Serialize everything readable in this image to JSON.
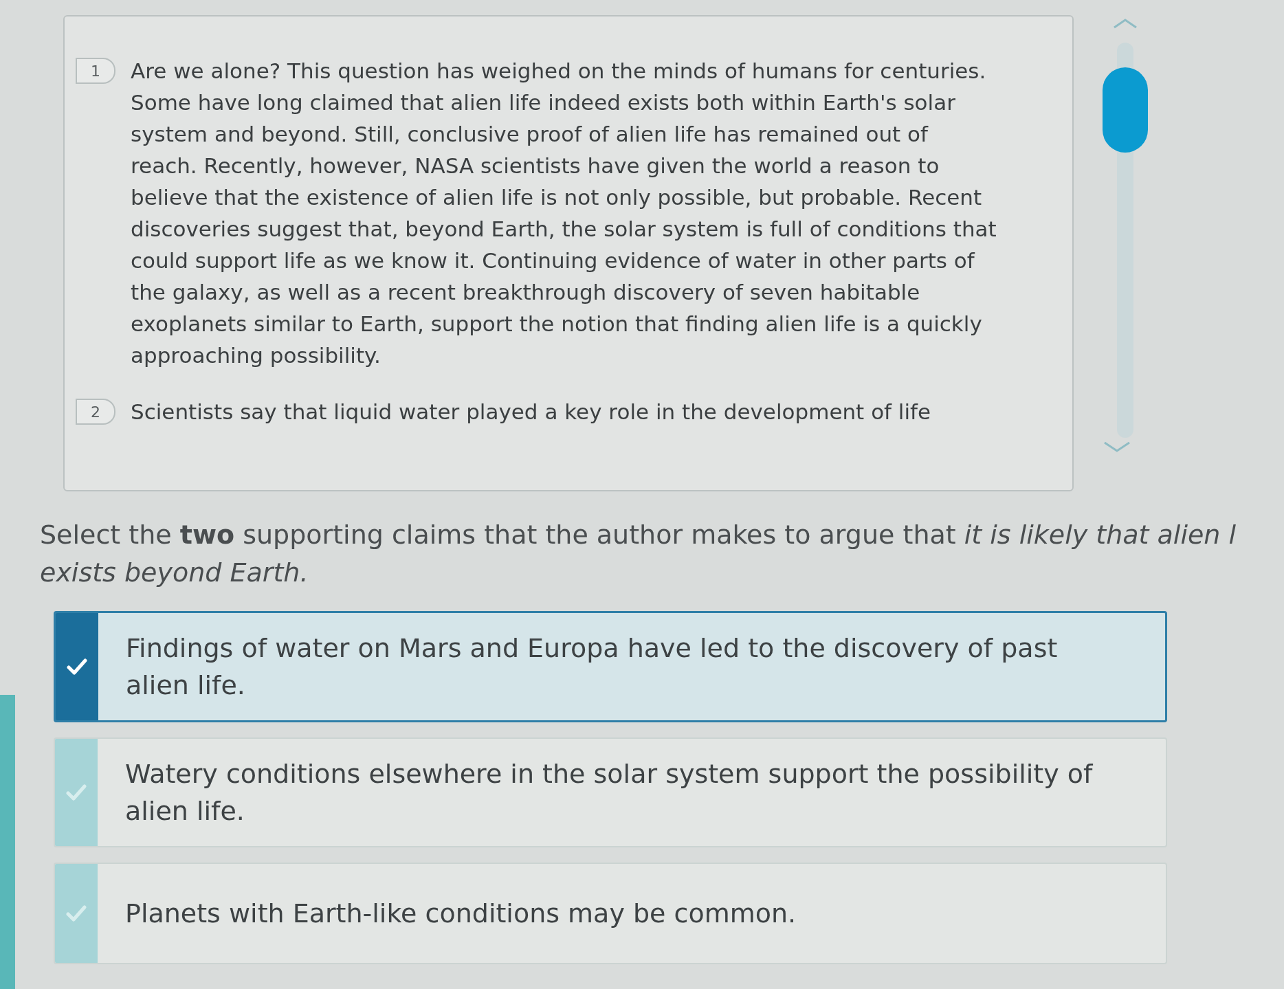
{
  "passage": {
    "paragraphs": [
      {
        "number": "1",
        "text": "Are we alone? This question has weighed on the minds of humans for centuries. Some have long claimed that alien life indeed exists both within Earth's solar system and beyond. Still, conclusive proof of alien life has remained out of reach. Recently, however, NASA scientists have given the world a reason to believe that the existence of alien life is not only possible, but probable. Recent discoveries suggest that, beyond Earth, the solar system is full of conditions that could support life as we know it. Continuing evidence of water in other parts of the galaxy, as well as a recent breakthrough discovery of seven habitable exoplanets similar to Earth, support the notion that finding alien life is a quickly approaching possibility."
      },
      {
        "number": "2",
        "text": "Scientists say that liquid water played a key role in the development of life"
      }
    ]
  },
  "prompt": {
    "lines": [
      "Select the **two** supporting claims that the author makes to argue that *it is likely that alien l*",
      "*exists beyond Earth.*"
    ]
  },
  "options": [
    {
      "text": "Findings of water on Mars and Europa have led to the discovery of past alien life.",
      "selected": true
    },
    {
      "text": "Watery conditions elsewhere in the solar system support the possibility of alien life.",
      "selected": false
    },
    {
      "text": "Planets with Earth-like conditions may be common.",
      "selected": false
    }
  ]
}
